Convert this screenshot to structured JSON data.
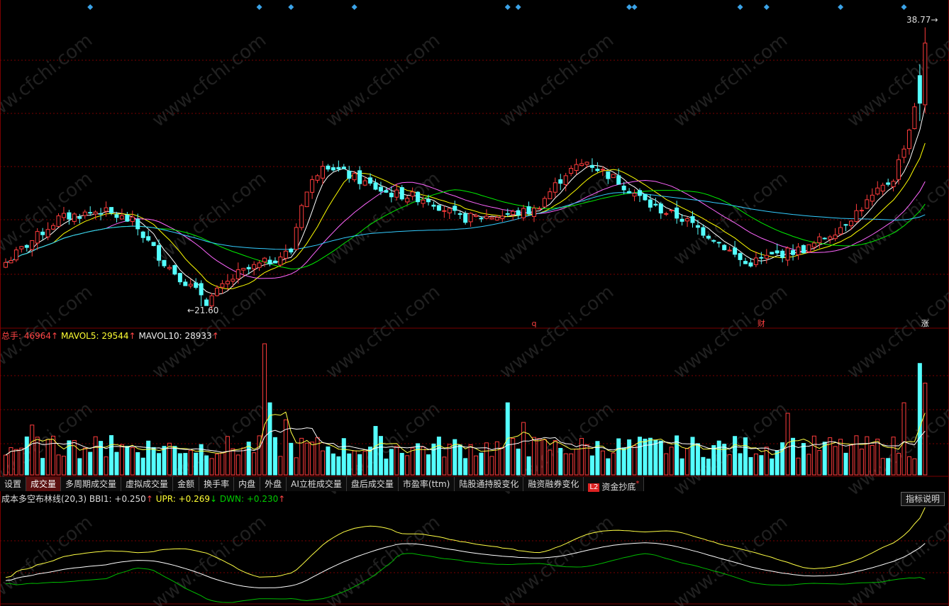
{
  "price_panel": {
    "high_label": "38.77",
    "low_label": "21.60",
    "low_arrow": "←",
    "high_arrow": "→",
    "event_markers": [
      {
        "text": "q",
        "color": "#ff4040",
        "bar": 100
      },
      {
        "text": "财",
        "color": "#ff4040",
        "bar": 143
      },
      {
        "text": "涨",
        "color": "#ffffff",
        "bar": 174
      }
    ]
  },
  "volume_panel": {
    "label": "总手: ",
    "value": "46964",
    "ma5_label": "MAVOL5: ",
    "ma5_value": "29544",
    "ma10_label": "MAVOL10: ",
    "ma10_value": "28933",
    "up_arrow": "↑"
  },
  "tabs": [
    {
      "label": "设置",
      "active": false
    },
    {
      "label": "成交量",
      "active": true
    },
    {
      "label": "多周期成交量",
      "active": false
    },
    {
      "label": "虚拟成交量",
      "active": false
    },
    {
      "label": "金额",
      "active": false
    },
    {
      "label": "换手率",
      "active": false
    },
    {
      "label": "内盘",
      "active": false
    },
    {
      "label": "外盘",
      "active": false
    },
    {
      "label": "AI立桩成交量",
      "active": false
    },
    {
      "label": "盘后成交量",
      "active": false
    },
    {
      "label": "市盈率(ttm)",
      "active": false
    },
    {
      "label": "陆股通持股变化",
      "active": false
    },
    {
      "label": "融资融券变化",
      "active": false
    },
    {
      "label": "资金抄底",
      "active": false,
      "badge": "L2",
      "star": "*"
    }
  ],
  "indicator_panel": {
    "name": "成本多空布林线(20,3)",
    "bbi_label": " BBI1: ",
    "bbi_value": "+0.250",
    "upr_label": " UPR: ",
    "upr_value": "+0.269",
    "dwn_label": " DWN: ",
    "dwn_value": "+0.230",
    "help_button": "指标说明",
    "up_arrow": "↑",
    "down_arrow": "↓"
  },
  "watermark": "www.cfchi.com",
  "colors": {
    "up": "#ff3c3c",
    "down": "#54ffff",
    "ma5": "#ffffff",
    "ma10": "#ffff00",
    "ma20": "#ff66ff",
    "ma30": "#00ee00",
    "ma60": "#33ccff",
    "grid": "#7a0000",
    "marker": "#3ba3e8"
  },
  "chart_data": {
    "type": "candlestick",
    "bars": 175,
    "price_range": [
      21.6,
      38.77
    ],
    "events": [
      "q",
      "财",
      "涨"
    ],
    "volume_series": [
      "volume",
      "MAVOL5",
      "MAVOL10"
    ],
    "indicator_series": [
      "BBI1",
      "UPR",
      "DWN"
    ]
  }
}
